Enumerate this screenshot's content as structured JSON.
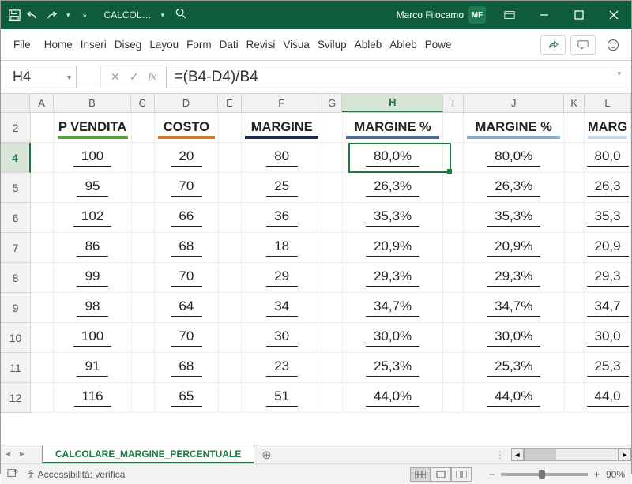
{
  "title": {
    "docname": "CALCOL…",
    "user": "Marco Filocamo",
    "initials": "MF"
  },
  "ribbon": {
    "file": "File",
    "tabs": [
      "Home",
      "Inseri",
      "Diseg",
      "Layou",
      "Form",
      "Dati",
      "Revisi",
      "Visua",
      "Svilup",
      "Ableb",
      "Ableb",
      "Powe"
    ]
  },
  "namebox": "H4",
  "formula": "=(B4-D4)/B4",
  "columns": [
    "A",
    "B",
    "C",
    "D",
    "E",
    "F",
    "G",
    "H",
    "I",
    "J",
    "K",
    "L"
  ],
  "rows": [
    "2",
    "4",
    "5",
    "6",
    "7",
    "8",
    "9",
    "10",
    "11",
    "12"
  ],
  "headers": {
    "B": "P VENDITA",
    "D": "COSTO",
    "F": "MARGINE",
    "H": "MARGINE %",
    "J": "MARGINE %",
    "L": "MARG"
  },
  "header_colors": {
    "B": "#5aa13e",
    "D": "#d07a2e",
    "F": "#1b2f4a",
    "H": "#4a6b8f",
    "J": "#8aabc9",
    "L": "#c6d6e6"
  },
  "data": [
    {
      "B": "100",
      "D": "20",
      "F": "80",
      "H": "80,0%",
      "J": "80,0%",
      "L": "80,0"
    },
    {
      "B": "95",
      "D": "70",
      "F": "25",
      "H": "26,3%",
      "J": "26,3%",
      "L": "26,3"
    },
    {
      "B": "102",
      "D": "66",
      "F": "36",
      "H": "35,3%",
      "J": "35,3%",
      "L": "35,3"
    },
    {
      "B": "86",
      "D": "68",
      "F": "18",
      "H": "20,9%",
      "J": "20,9%",
      "L": "20,9"
    },
    {
      "B": "99",
      "D": "70",
      "F": "29",
      "H": "29,3%",
      "J": "29,3%",
      "L": "29,3"
    },
    {
      "B": "98",
      "D": "64",
      "F": "34",
      "H": "34,7%",
      "J": "34,7%",
      "L": "34,7"
    },
    {
      "B": "100",
      "D": "70",
      "F": "30",
      "H": "30,0%",
      "J": "30,0%",
      "L": "30,0"
    },
    {
      "B": "91",
      "D": "68",
      "F": "23",
      "H": "25,3%",
      "J": "25,3%",
      "L": "25,3"
    },
    {
      "B": "116",
      "D": "65",
      "F": "51",
      "H": "44,0%",
      "J": "44,0%",
      "L": "44,0"
    }
  ],
  "selected": {
    "col": "H",
    "row": "4"
  },
  "sheet": "CALCOLARE_MARGINE_PERCENTUALE",
  "status": {
    "access": "Accessibilità: verifica",
    "zoom": "90%"
  }
}
